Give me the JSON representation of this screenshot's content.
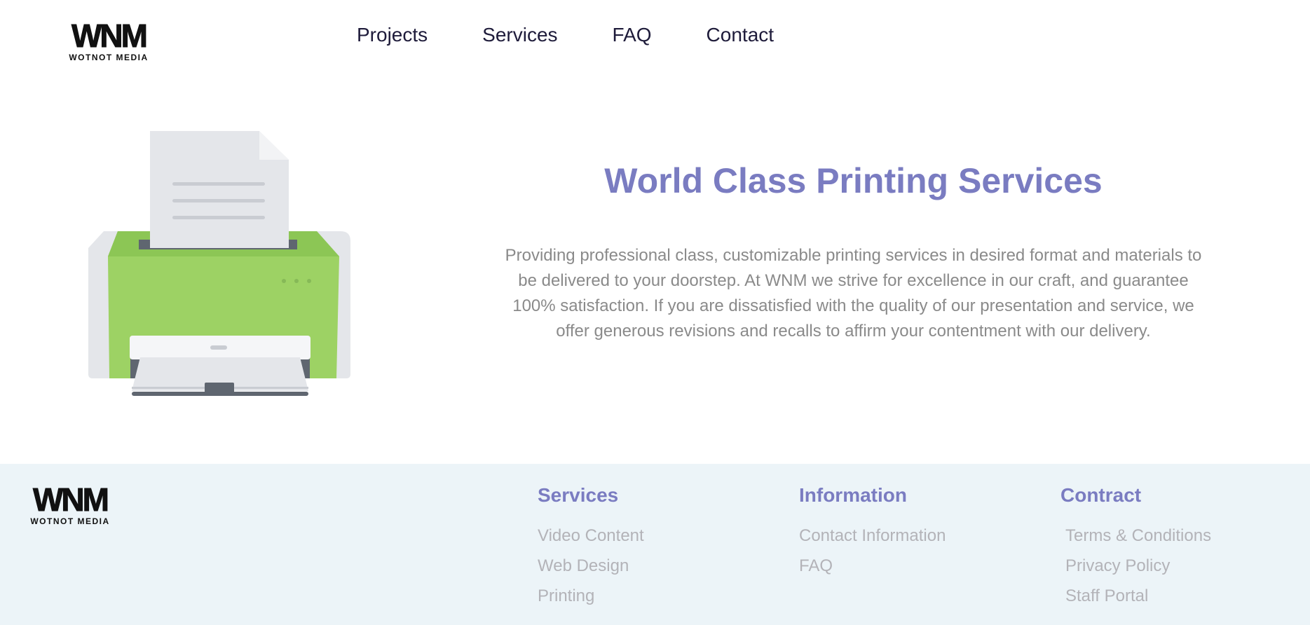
{
  "brand": {
    "logo_text": "WNM",
    "logo_subtext": "WOTNOT MEDIA"
  },
  "nav": {
    "items": [
      {
        "label": "Projects"
      },
      {
        "label": "Services"
      },
      {
        "label": "FAQ"
      },
      {
        "label": "Contact"
      }
    ]
  },
  "hero": {
    "illustration": "printer-illustration",
    "title": "World Class Printing Services",
    "description": "Providing professional class, customizable printing services in desired format and materials to be delivered to your doorstep. At WNM we strive for excellence in our craft, and guarantee 100% satisfaction. If you are dissatisfied with the quality of our presentation and service, we offer generous revisions and recalls to affirm your contentment with our delivery."
  },
  "footer": {
    "columns": [
      {
        "heading": "Services",
        "links": [
          "Video Content",
          "Web Design",
          "Printing"
        ]
      },
      {
        "heading": "Information",
        "links": [
          "Contact Information",
          "FAQ"
        ]
      },
      {
        "heading": "Contract",
        "links": [
          "Terms & Conditions",
          "Privacy Policy",
          "Staff Portal"
        ]
      }
    ]
  },
  "colors": {
    "accent": "#7a7cc1",
    "body_text": "#8a8a8a",
    "footer_bg": "#ecf4f8",
    "footer_link": "#b3b3b8",
    "printer_green": "#9dd264"
  }
}
